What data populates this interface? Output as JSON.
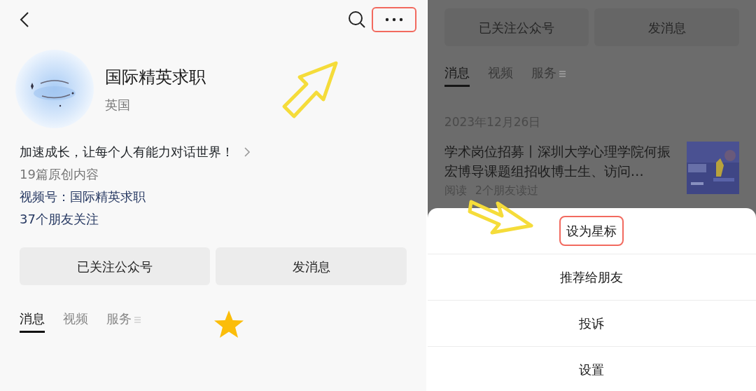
{
  "top_bar": {
    "more_highlighted": true
  },
  "profile": {
    "name": "国际精英求职",
    "region": "英国",
    "bio": "加速成长，让每个人有能力对话世界！",
    "original_count": "19篇原创内容",
    "channel": "视频号：国际精英求职",
    "friends": "37个朋友关注"
  },
  "buttons": [
    "已关注公众号",
    "发消息"
  ],
  "tabs": [
    {
      "label": "消息",
      "selected": true
    },
    {
      "label": "视频",
      "selected": false
    },
    {
      "label": "服务",
      "selected": false
    }
  ],
  "scrolled_view": {
    "buttons": [
      "已关注公众号",
      "发消息"
    ],
    "tabs": [
      {
        "label": "消息",
        "selected": true
      },
      {
        "label": "视频",
        "selected": false
      },
      {
        "label": "服务",
        "selected": false
      }
    ],
    "article": {
      "date": "2023年12月26日",
      "title": "学术岗位招募丨深圳大学心理学院何振宏博导课题组招收博士生、访问…",
      "reads": "阅读",
      "friends_read": "2个朋友读过"
    }
  },
  "action_sheet": {
    "items": [
      {
        "label": "设为星标",
        "highlighted": true
      },
      {
        "label": "推荐给朋友",
        "highlighted": false
      },
      {
        "label": "投诉",
        "highlighted": false
      },
      {
        "label": "设置",
        "highlighted": false
      }
    ]
  }
}
